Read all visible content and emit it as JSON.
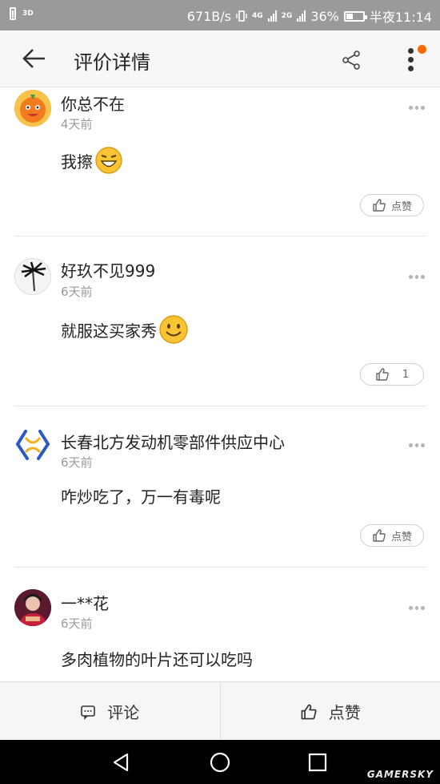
{
  "status_bar": {
    "left_badge": "3D",
    "speed": "671B/s",
    "net_a": "4G",
    "net_b": "2G",
    "battery_pct": "36%",
    "time": "半夜11:14"
  },
  "header": {
    "title": "评价详情",
    "icons": [
      "back-arrow-icon",
      "share-icon",
      "more-vertical-icon"
    ]
  },
  "comments": [
    {
      "author": "你总不在",
      "time": "4天前",
      "content": "我擦",
      "emoji": "grinning-emoji",
      "like_label": "点赞"
    },
    {
      "author": "好玖不见999",
      "time": "6天前",
      "content": "就服这买家秀",
      "emoji": "smile-emoji",
      "like_label": "1"
    },
    {
      "author": "长春北方发动机零部件供应中心",
      "time": "6天前",
      "content": "咋炒吃了，万一有毒呢",
      "like_label": "点赞"
    },
    {
      "author": "一**花",
      "time": "6天前",
      "content": "多肉植物的叶片还可以吃吗"
    }
  ],
  "action_bar": {
    "comment_label": "评论",
    "like_label": "点赞"
  },
  "nav": {
    "icons": [
      "back-triangle-icon",
      "home-circle-icon",
      "recents-square-icon"
    ]
  },
  "watermark": "GAMERSKY",
  "colors": {
    "status_bar": "#9a9a9a",
    "badge": "#ff6a00",
    "muted_text": "#9a9a9a"
  }
}
